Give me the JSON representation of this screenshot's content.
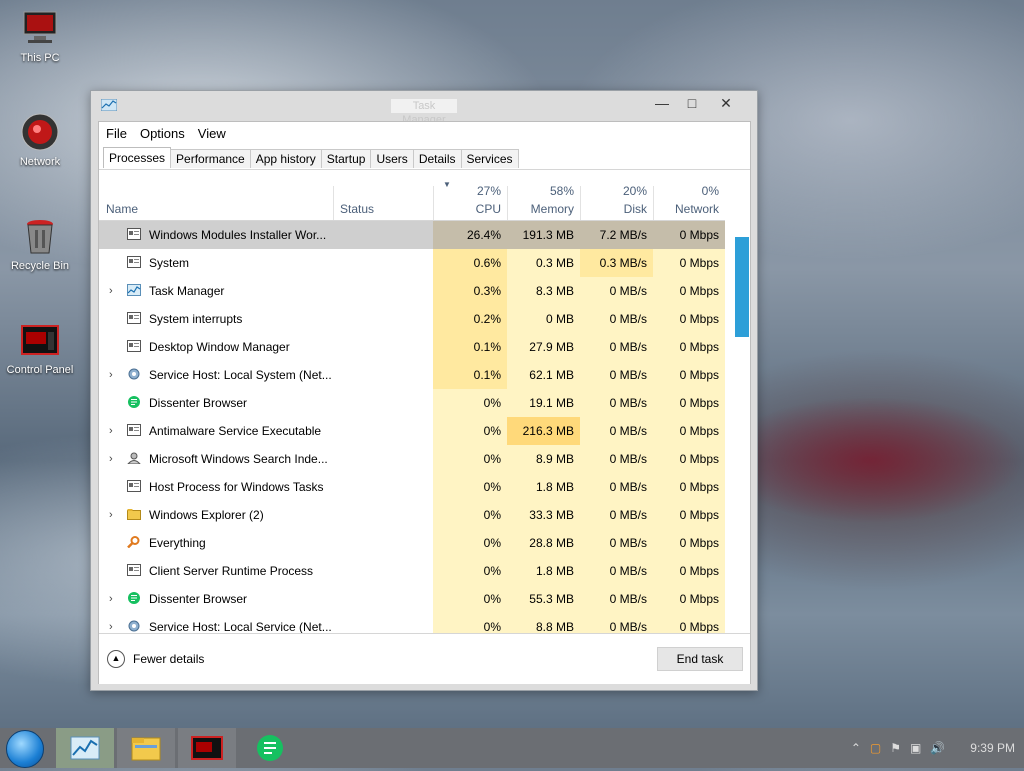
{
  "desktop": {
    "icons": [
      {
        "label": "This PC",
        "icon": "computer-icon"
      },
      {
        "label": "Network",
        "icon": "network-icon"
      },
      {
        "label": "Recycle Bin",
        "icon": "recycle-bin-icon"
      },
      {
        "label": "Control Panel",
        "icon": "control-panel-icon"
      }
    ]
  },
  "window": {
    "title": "Task Manager",
    "menu": [
      "File",
      "Options",
      "View"
    ],
    "tabs": [
      "Processes",
      "Performance",
      "App history",
      "Startup",
      "Users",
      "Details",
      "Services"
    ],
    "active_tab": "Processes",
    "columns": {
      "name": "Name",
      "status": "Status",
      "cpu": {
        "pct": "27%",
        "label": "CPU"
      },
      "memory": {
        "pct": "58%",
        "label": "Memory"
      },
      "disk": {
        "pct": "20%",
        "label": "Disk"
      },
      "network": {
        "pct": "0%",
        "label": "Network"
      }
    },
    "processes": [
      {
        "name": "Windows Modules Installer Wor...",
        "expand": "",
        "icon": "service-window-icon",
        "cpu": "26.4%",
        "memory": "191.3 MB",
        "disk": "7.2 MB/s",
        "network": "0 Mbps",
        "selected": true
      },
      {
        "name": "System",
        "expand": "",
        "icon": "service-window-icon",
        "cpu": "0.6%",
        "memory": "0.3 MB",
        "disk": "0.3 MB/s",
        "network": "0 Mbps"
      },
      {
        "name": "Task Manager",
        "expand": "›",
        "icon": "task-manager-icon",
        "cpu": "0.3%",
        "memory": "8.3 MB",
        "disk": "0 MB/s",
        "network": "0 Mbps"
      },
      {
        "name": "System interrupts",
        "expand": "",
        "icon": "service-window-icon",
        "cpu": "0.2%",
        "memory": "0 MB",
        "disk": "0 MB/s",
        "network": "0 Mbps"
      },
      {
        "name": "Desktop Window Manager",
        "expand": "",
        "icon": "service-window-icon",
        "cpu": "0.1%",
        "memory": "27.9 MB",
        "disk": "0 MB/s",
        "network": "0 Mbps"
      },
      {
        "name": "Service Host: Local System (Net...",
        "expand": "›",
        "icon": "gear-icon",
        "cpu": "0.1%",
        "memory": "62.1 MB",
        "disk": "0 MB/s",
        "network": "0 Mbps"
      },
      {
        "name": "Dissenter Browser",
        "expand": "",
        "icon": "dissenter-icon",
        "cpu": "0%",
        "memory": "19.1 MB",
        "disk": "0 MB/s",
        "network": "0 Mbps"
      },
      {
        "name": "Antimalware Service Executable",
        "expand": "›",
        "icon": "service-window-icon",
        "cpu": "0%",
        "memory": "216.3 MB",
        "disk": "0 MB/s",
        "network": "0 Mbps"
      },
      {
        "name": "Microsoft Windows Search Inde...",
        "expand": "›",
        "icon": "search-user-icon",
        "cpu": "0%",
        "memory": "8.9 MB",
        "disk": "0 MB/s",
        "network": "0 Mbps"
      },
      {
        "name": "Host Process for Windows Tasks",
        "expand": "",
        "icon": "service-window-icon",
        "cpu": "0%",
        "memory": "1.8 MB",
        "disk": "0 MB/s",
        "network": "0 Mbps"
      },
      {
        "name": "Windows Explorer (2)",
        "expand": "›",
        "icon": "folder-icon",
        "cpu": "0%",
        "memory": "33.3 MB",
        "disk": "0 MB/s",
        "network": "0 Mbps"
      },
      {
        "name": "Everything",
        "expand": "",
        "icon": "magnifier-icon",
        "cpu": "0%",
        "memory": "28.8 MB",
        "disk": "0 MB/s",
        "network": "0 Mbps"
      },
      {
        "name": "Client Server Runtime Process",
        "expand": "",
        "icon": "service-window-icon",
        "cpu": "0%",
        "memory": "1.8 MB",
        "disk": "0 MB/s",
        "network": "0 Mbps"
      },
      {
        "name": "Dissenter Browser",
        "expand": "›",
        "icon": "dissenter-icon",
        "cpu": "0%",
        "memory": "55.3 MB",
        "disk": "0 MB/s",
        "network": "0 Mbps"
      },
      {
        "name": "Service Host: Local Service (Net...",
        "expand": "›",
        "icon": "gear-icon",
        "cpu": "0%",
        "memory": "8.8 MB",
        "disk": "0 MB/s",
        "network": "0 Mbps"
      }
    ],
    "footer": {
      "fewer_details": "Fewer details",
      "end_task": "End task"
    }
  },
  "taskbar": {
    "apps": [
      "task-manager-icon",
      "file-explorer-icon",
      "control-panel-icon",
      "dissenter-icon"
    ],
    "clock": "9:39 PM"
  },
  "colors": {
    "heat_light": "#fff4c4",
    "heat_mid": "#ffe9a0",
    "heat_strong": "#ffd97a",
    "selected_row": "#cfcfcf",
    "scroll_thumb": "#2d9fd8",
    "header_text": "#4c607a"
  }
}
